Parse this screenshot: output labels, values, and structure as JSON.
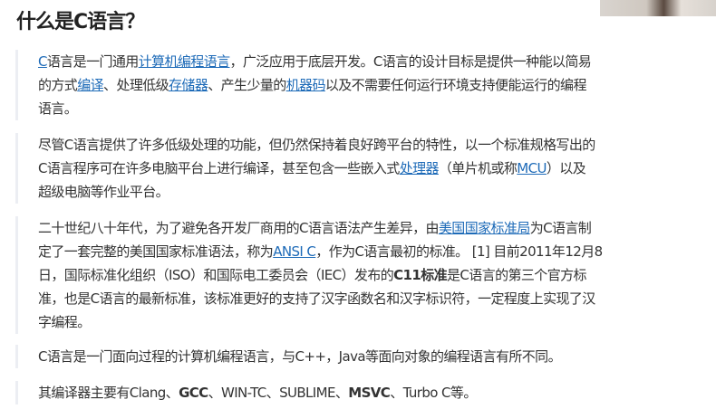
{
  "title": "什么是C语言？",
  "paragraphs": [
    {
      "segments": [
        {
          "t": "C",
          "link": true
        },
        {
          "t": "语言是一门通用"
        },
        {
          "t": "计算机编程语言",
          "link": true
        },
        {
          "t": "，广泛应用于底层开发。C语言的设计目标是提供一种能以简易"
        },
        {
          "br": true
        },
        {
          "t": "的方式"
        },
        {
          "t": "编译",
          "link": true
        },
        {
          "t": "、处理低级"
        },
        {
          "t": "存储器",
          "link": true
        },
        {
          "t": "、产生少量的"
        },
        {
          "t": "机器码",
          "link": true
        },
        {
          "t": "以及不需要任何运行环境支持便能运行的编程"
        },
        {
          "br": true
        },
        {
          "t": "语言。"
        }
      ]
    },
    {
      "segments": [
        {
          "t": "尽管C语言提供了许多低级处理的功能，但仍然保持着良好跨平台的特性，以一个标准规格写出的"
        },
        {
          "br": true
        },
        {
          "t": "C语言程序可在许多电脑平台上进行编译，甚至包含一些嵌入式"
        },
        {
          "t": "处理器",
          "link": true
        },
        {
          "t": "（单片机或称"
        },
        {
          "t": "MCU",
          "link": true
        },
        {
          "t": "）以及"
        },
        {
          "br": true
        },
        {
          "t": "超级电脑等作业平台。"
        }
      ]
    },
    {
      "segments": [
        {
          "t": "二十世纪八十年代，为了避免各开发厂商用的C语言语法产生差异，由"
        },
        {
          "t": "美国国家标准局",
          "link": true
        },
        {
          "t": "为C语言制"
        },
        {
          "br": true
        },
        {
          "t": "定了一套完整的美国国家标准语法，称为"
        },
        {
          "t": "ANSI C",
          "link": true
        },
        {
          "t": "，作为C语言最初的标准。 [1] 目前2011年12月8"
        },
        {
          "br": true
        },
        {
          "t": "日，国际标准化组织（ISO）和国际电工委员会（IEC）发布的"
        },
        {
          "t": "C11标准",
          "bold": true
        },
        {
          "t": "是C语言的第三个官方标"
        },
        {
          "br": true
        },
        {
          "t": "准，也是C语言的最新标准，该标准更好的支持了汉字函数名和汉字标识符，一定程度上实现了汉"
        },
        {
          "br": true
        },
        {
          "t": "字编程。"
        }
      ]
    },
    {
      "segments": [
        {
          "t": "C语言是一门面向过程的计算机编程语言，与C++，Java等面向对象的编程语言有所不同。"
        }
      ]
    },
    {
      "segments": [
        {
          "t": "其编译器主要有Clang、"
        },
        {
          "t": "GCC",
          "bold": true
        },
        {
          "t": "、WIN-TC、SUBLIME、"
        },
        {
          "t": "MSVC",
          "bold": true
        },
        {
          "t": "、Turbo C等。"
        }
      ]
    }
  ]
}
